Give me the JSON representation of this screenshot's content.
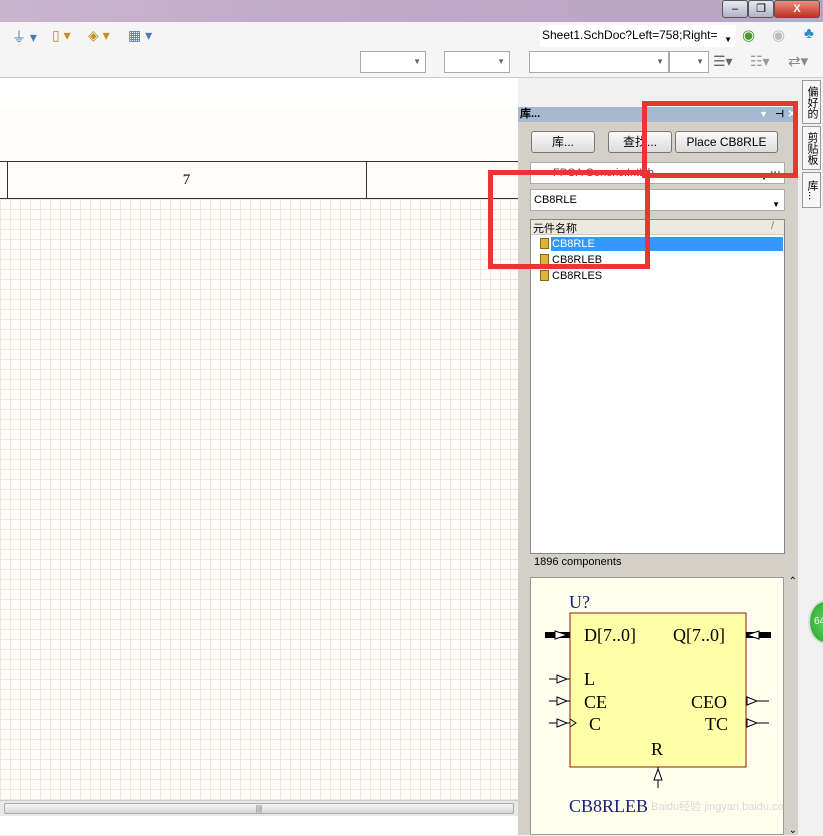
{
  "window": {
    "minimize": "–",
    "restore": "❐",
    "close": "X"
  },
  "toolbar": {
    "nav_path": "Sheet1.SchDoc?Left=758;Right="
  },
  "sheet": {
    "zone_label": "7"
  },
  "panel": {
    "title": "库...",
    "buttons": {
      "libraries": "库...",
      "search": "查找...",
      "place": "Place CB8RLE"
    },
    "library_select": "FPGA Generic.IntLib",
    "filter_value": "CB8RLE",
    "list_header": "元件名称",
    "sort_marker": "/",
    "components": [
      "CB8RLE",
      "CB8RLEB",
      "CB8RLES"
    ],
    "selected_index": 0,
    "count": "1896 components",
    "preview": {
      "designator": "U?",
      "comment": "CB8RLEB",
      "pins": {
        "d": "D[7..0]",
        "q": "Q[7..0]",
        "l": "L",
        "ce": "CE",
        "c": "C",
        "ceo": "CEO",
        "tc": "TC",
        "r": "R"
      }
    },
    "watermark": "Baidu经验 jingyan.baidu.com"
  },
  "side_tabs": [
    "偏好的",
    "剪贴板",
    "库..."
  ],
  "badge": "64"
}
